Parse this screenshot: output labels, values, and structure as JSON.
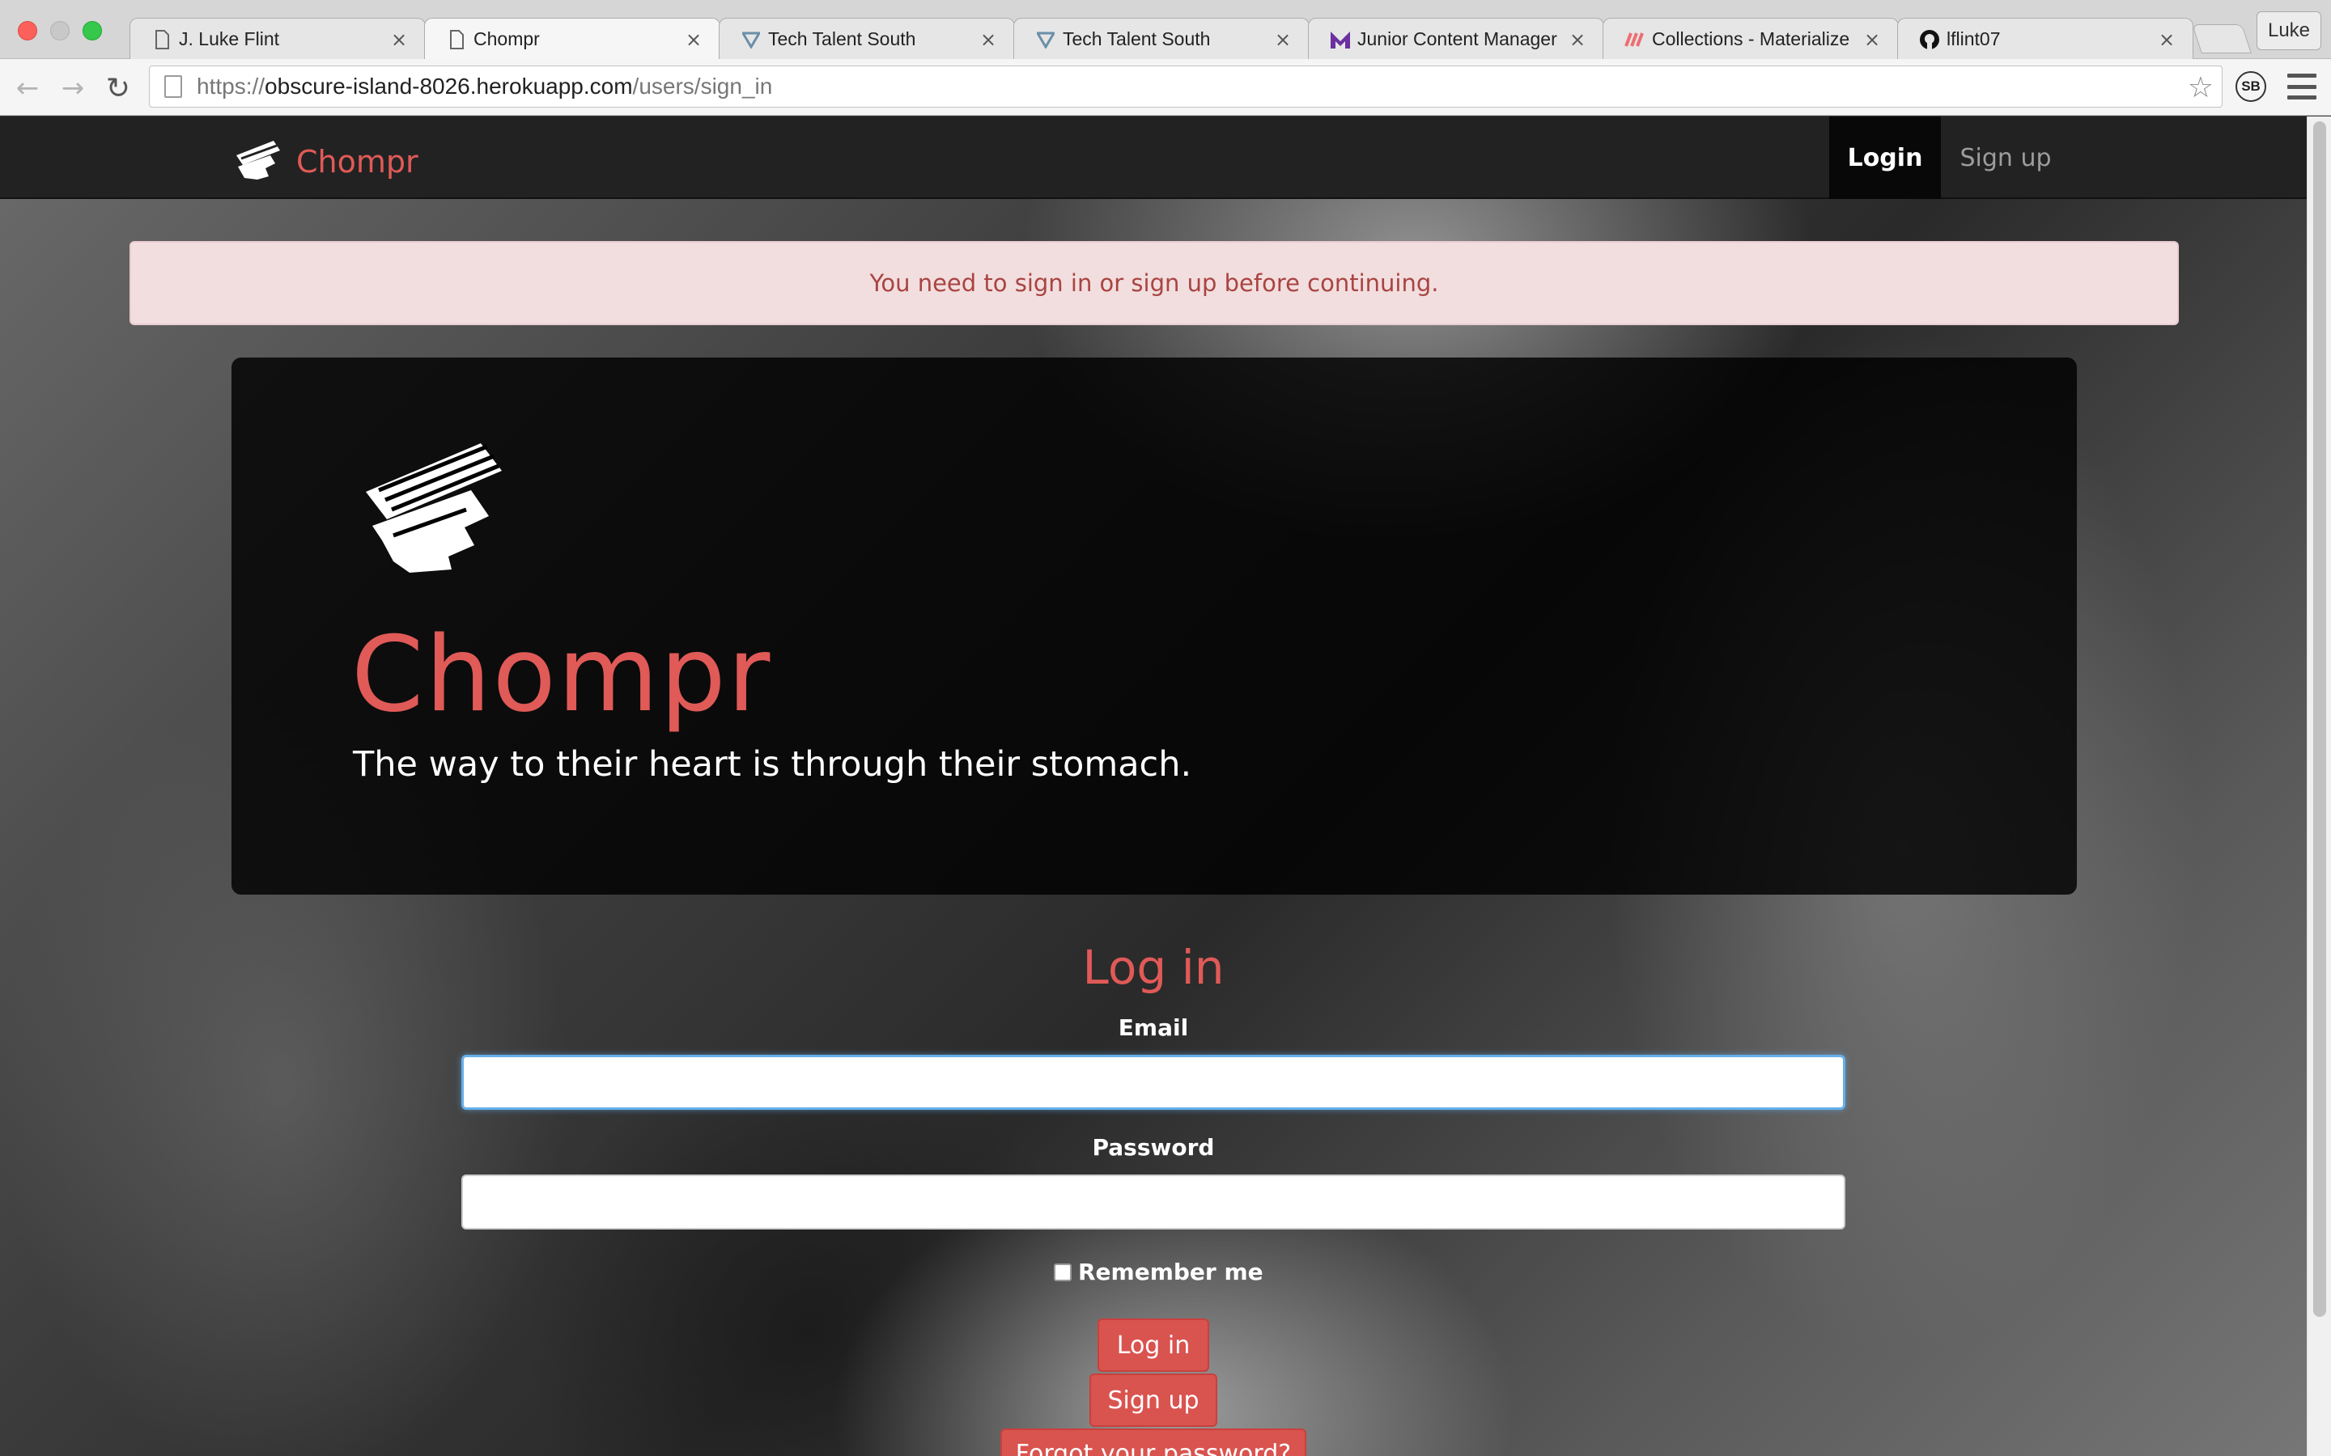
{
  "browser": {
    "tabs": [
      {
        "label": "J. Luke Flint",
        "icon": "page-icon"
      },
      {
        "label": "Chompr",
        "icon": "page-icon",
        "active": true
      },
      {
        "label": "Tech Talent South",
        "icon": "tts-icon"
      },
      {
        "label": "Tech Talent South",
        "icon": "tts-icon"
      },
      {
        "label": "Junior Content Manager",
        "icon": "m-logo-icon"
      },
      {
        "label": "Collections - Materialize",
        "icon": "materialize-icon"
      },
      {
        "label": "lflint07",
        "icon": "github-icon"
      }
    ],
    "close_glyph": "×",
    "profile_name": "Luke",
    "url_scheme": "https://",
    "url_host": "obscure-island-8026.herokuapp.com",
    "url_path": "/users/sign_in",
    "extension_label": "SB"
  },
  "navbar": {
    "brand": "Chompr",
    "login": "Login",
    "signup": "Sign up"
  },
  "alert": {
    "message": "You need to sign in or sign up before continuing."
  },
  "hero": {
    "title": "Chompr",
    "tagline": "The way to their heart is through their stomach."
  },
  "form": {
    "title": "Log in",
    "email_label": "Email",
    "email_value": "",
    "password_label": "Password",
    "password_value": "",
    "remember_label": "Remember me",
    "login_button": "Log in",
    "signup_button": "Sign up",
    "forgot_button": "Forgot your password?"
  },
  "colors": {
    "brand_red": "#e05a57",
    "alert_bg": "#f2dede",
    "alert_text": "#a94442",
    "navbar_bg": "#222222"
  }
}
